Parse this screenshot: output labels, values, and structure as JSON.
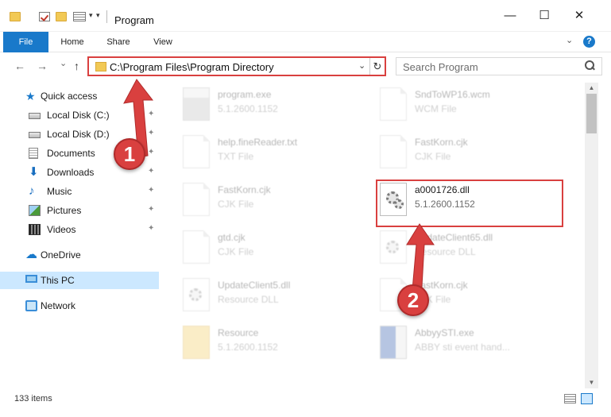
{
  "window": {
    "title": "Program",
    "minimize_glyph": "—",
    "maximize_glyph": "☐",
    "close_glyph": "✕"
  },
  "ribbon": {
    "tabs": [
      "File",
      "Home",
      "Share",
      "View"
    ],
    "help_glyph": "?",
    "expand_glyph": "⌄"
  },
  "nav": {
    "back_glyph": "←",
    "forward_glyph": "→",
    "recent_glyph": "⌄",
    "up_glyph": "↑",
    "address": "C:\\Program Files\\Program Directory",
    "address_dropdown_glyph": "⌄",
    "refresh_glyph": "↻",
    "search_placeholder": "Search Program"
  },
  "sidebar": {
    "quick_access": "Quick access",
    "items": [
      {
        "label": "Local Disk (C:)",
        "icon": "drive-icon",
        "pinned": true
      },
      {
        "label": "Local Disk (D:)",
        "icon": "drive-icon",
        "pinned": true
      },
      {
        "label": "Documents",
        "icon": "documents-icon",
        "pinned": true
      },
      {
        "label": "Downloads",
        "icon": "downloads-icon",
        "pinned": true
      },
      {
        "label": "Music",
        "icon": "music-icon",
        "pinned": true
      },
      {
        "label": "Pictures",
        "icon": "pictures-icon",
        "pinned": true
      },
      {
        "label": "Videos",
        "icon": "videos-icon",
        "pinned": true
      }
    ],
    "pin_glyph": "📌",
    "onedrive": "OneDrive",
    "this_pc": "This PC",
    "network": "Network"
  },
  "files": [
    {
      "name": "program.exe",
      "sub": "5.1.2600.1152",
      "icon": "exe-icon",
      "faded": true
    },
    {
      "name": "SndToWP16.wcm",
      "sub": "WCM File",
      "icon": "document-icon",
      "faded": true
    },
    {
      "name": "help.fineReader.txt",
      "sub": "TXT File",
      "icon": "document-icon",
      "faded": true
    },
    {
      "name": "FastKorn.cjk",
      "sub": "CJK File",
      "icon": "document-icon",
      "faded": true
    },
    {
      "name": "FastKorn.cjk",
      "sub": "CJK File",
      "icon": "document-icon",
      "faded": true
    },
    {
      "name": "a0001726.dll",
      "sub": "5.1.2600.1152",
      "icon": "dll-icon",
      "faded": false
    },
    {
      "name": "gtd.cjk",
      "sub": "CJK File",
      "icon": "document-icon",
      "faded": true
    },
    {
      "name": "UpdateClient65.dll",
      "sub": "Resource DLL",
      "icon": "dll-icon",
      "faded": true
    },
    {
      "name": "UpdateClient5.dll",
      "sub": "Resource DLL",
      "icon": "dll-icon",
      "faded": true
    },
    {
      "name": "FastKorn.cjk",
      "sub": "CJK File",
      "icon": "document-icon",
      "faded": true
    },
    {
      "name": "Resource",
      "sub": "5.1.2600.1152",
      "icon": "folder-icon",
      "faded": true
    },
    {
      "name": "AbbyySTI.exe",
      "sub": "ABBY sti event hand...",
      "icon": "exe-icon",
      "faded": true
    }
  ],
  "status": {
    "item_count": "133 items"
  },
  "annotations": {
    "step1": "1",
    "step2": "2",
    "accent_color": "#d9403f"
  }
}
